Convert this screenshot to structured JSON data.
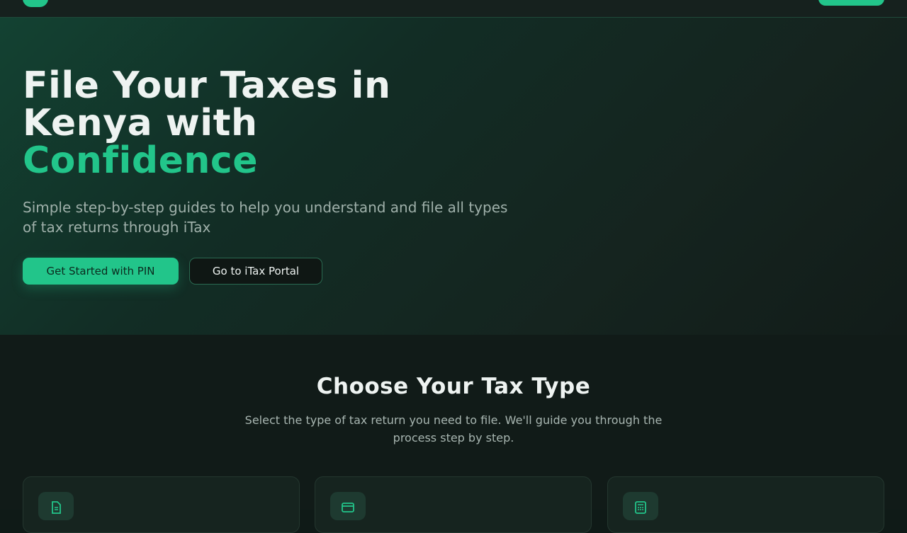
{
  "hero": {
    "title_line1": "File Your Taxes in",
    "title_line2": "Kenya with",
    "title_accent": "Confidence",
    "subtitle": "Simple step-by-step guides to help you understand and file all types of tax returns through iTax",
    "primary_button": "Get Started with PIN",
    "secondary_button": "Go to iTax Portal"
  },
  "tax_types": {
    "title": "Choose Your Tax Type",
    "subtitle": "Select the type of tax return you need to file. We'll guide you through the process step by step.",
    "cards": [
      {
        "icon": "document-icon"
      },
      {
        "icon": "wallet-icon"
      },
      {
        "icon": "calculator-icon"
      }
    ]
  },
  "colors": {
    "accent": "#22c58a",
    "background": "#0f1a17",
    "hero_gradient_start": "#134232"
  }
}
